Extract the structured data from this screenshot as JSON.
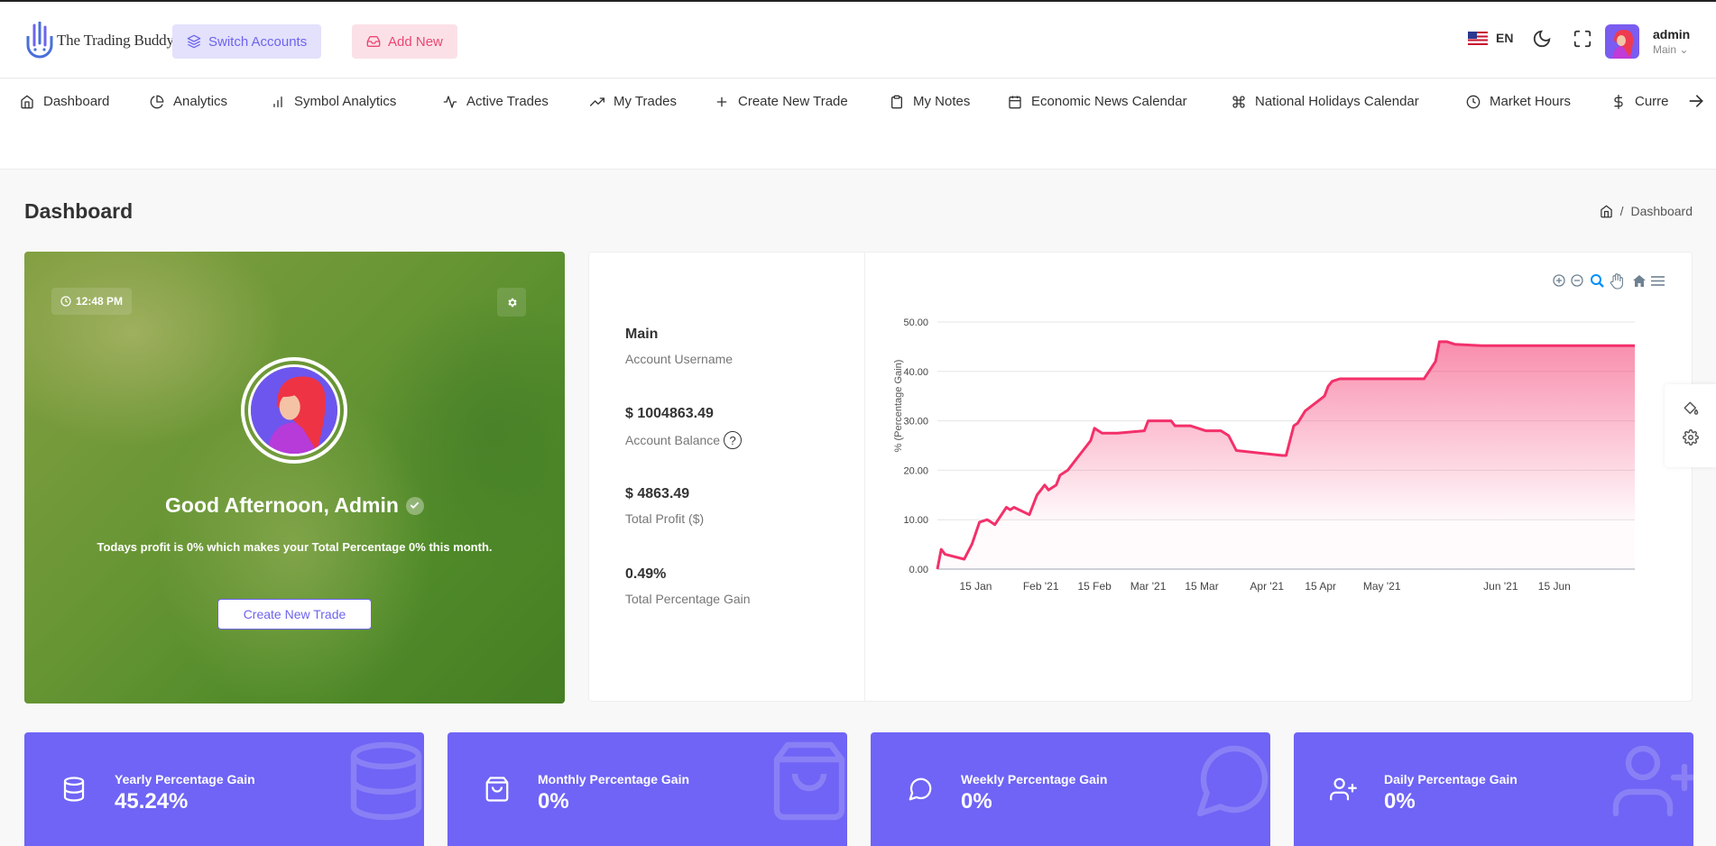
{
  "header": {
    "brand": "The Trading Buddy",
    "switch_label": "Switch Accounts",
    "add_label": "Add New",
    "language": "EN",
    "user_name": "admin",
    "user_role": "Main"
  },
  "nav": {
    "items": [
      {
        "label": "Dashboard",
        "icon": "home-icon"
      },
      {
        "label": "Analytics",
        "icon": "pie-chart-icon"
      },
      {
        "label": "Symbol Analytics",
        "icon": "bar-chart-icon"
      },
      {
        "label": "Active Trades",
        "icon": "activity-icon"
      },
      {
        "label": "My Trades",
        "icon": "trending-up-icon"
      },
      {
        "label": "Create New Trade",
        "icon": "plus-icon"
      },
      {
        "label": "My Notes",
        "icon": "clipboard-icon"
      },
      {
        "label": "Economic News Calendar",
        "icon": "calendar-icon"
      },
      {
        "label": "National Holidays Calendar",
        "icon": "command-icon"
      },
      {
        "label": "Market Hours",
        "icon": "clock-icon"
      },
      {
        "label": "Curre",
        "icon": "dollar-icon"
      }
    ]
  },
  "page": {
    "title": "Dashboard",
    "breadcrumb": "Dashboard"
  },
  "welcome": {
    "time": "12:48 PM",
    "greeting": "Good Afternoon, Admin",
    "message": "Todays profit is 0% which makes your Total Percentage 0% this month.",
    "button_label": "Create New Trade"
  },
  "account": {
    "username_value": "Main",
    "username_label": "Account Username",
    "balance_value": "$ 1004863.49",
    "balance_label": "Account Balance",
    "profit_value": "$ 4863.49",
    "profit_label": "Total Profit ($)",
    "gain_value": "0.49%",
    "gain_label": "Total Percentage Gain"
  },
  "tiles": [
    {
      "title": "Yearly Percentage Gain",
      "value": "45.24%",
      "icon": "database-icon"
    },
    {
      "title": "Monthly Percentage Gain",
      "value": "0%",
      "icon": "shopping-bag-icon"
    },
    {
      "title": "Weekly Percentage Gain",
      "value": "0%",
      "icon": "message-circle-icon"
    },
    {
      "title": "Daily Percentage Gain",
      "value": "0%",
      "icon": "user-plus-icon"
    }
  ],
  "colors": {
    "accent": "#6f64f5",
    "pink": "#f3306a"
  },
  "chart_data": {
    "type": "area",
    "ylabel": "% (Percentage Gain)",
    "ylim": [
      0,
      50
    ],
    "yticks": [
      "0.00",
      "10.00",
      "20.00",
      "30.00",
      "40.00",
      "50.00"
    ],
    "xtick_labels": [
      "15 Jan",
      "Feb '21",
      "15 Feb",
      "Mar '21",
      "15 Mar",
      "Apr '21",
      "15 Apr",
      "May '21",
      "Jun '21",
      "15 Jun"
    ],
    "x_range": [
      "2021-01-05",
      "2021-07-06"
    ],
    "series": [
      {
        "x": [
          "2021-01-05",
          "2021-01-06",
          "2021-01-07",
          "2021-01-12",
          "2021-01-14",
          "2021-01-16",
          "2021-01-18",
          "2021-01-19",
          "2021-01-20",
          "2021-01-23",
          "2021-01-24",
          "2021-01-25",
          "2021-01-29",
          "2021-01-31",
          "2021-02-01",
          "2021-02-02",
          "2021-02-03",
          "2021-02-05",
          "2021-02-06",
          "2021-02-08",
          "2021-02-10",
          "2021-02-12",
          "2021-02-14",
          "2021-02-15",
          "2021-02-16",
          "2021-02-17",
          "2021-02-19",
          "2021-02-21",
          "2021-02-28",
          "2021-03-01",
          "2021-03-07",
          "2021-03-08",
          "2021-03-12",
          "2021-03-16",
          "2021-03-20",
          "2021-03-22",
          "2021-03-24",
          "2021-04-05",
          "2021-04-06",
          "2021-04-08",
          "2021-04-09",
          "2021-04-11",
          "2021-04-16",
          "2021-04-17",
          "2021-04-18",
          "2021-04-20",
          "2021-04-23",
          "2021-05-12",
          "2021-05-15",
          "2021-05-16",
          "2021-05-18",
          "2021-05-20",
          "2021-05-27",
          "2021-07-06"
        ],
        "values": [
          0.0,
          4.0,
          3.0,
          2.0,
          5.0,
          9.5,
          10.0,
          9.5,
          9.0,
          12.5,
          12.0,
          12.5,
          11.0,
          15.0,
          16.0,
          17.0,
          16.0,
          17.0,
          19.0,
          20.0,
          22.0,
          24.0,
          26.0,
          28.5,
          28.0,
          27.5,
          27.5,
          27.5,
          28.0,
          30.0,
          30.0,
          29.0,
          29.0,
          28.0,
          28.0,
          27.0,
          24.0,
          23.0,
          23.0,
          29.0,
          29.5,
          32.0,
          35.0,
          37.0,
          38.0,
          38.5,
          38.5,
          38.5,
          42.0,
          46.0,
          46.0,
          45.5,
          45.2,
          45.2
        ]
      }
    ],
    "grid": true
  }
}
